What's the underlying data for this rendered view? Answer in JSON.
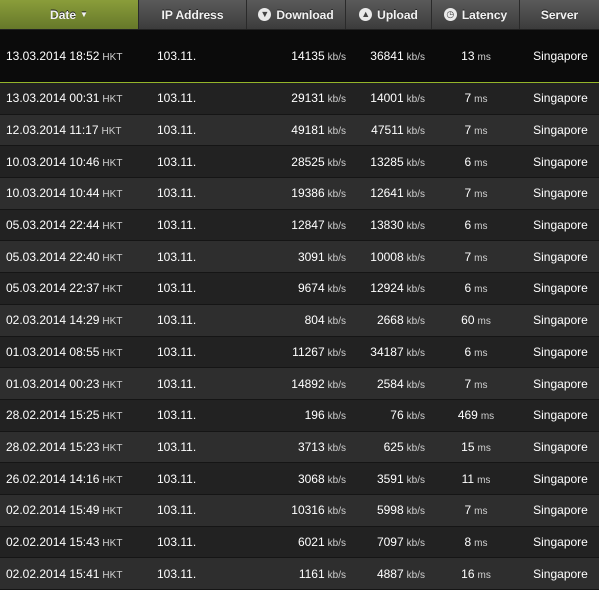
{
  "header": {
    "date": "Date",
    "ip": "IP Address",
    "download": "Download",
    "upload": "Upload",
    "latency": "Latency",
    "server": "Server"
  },
  "icons": {
    "download": "download-icon",
    "upload": "upload-icon",
    "latency": "latency-icon",
    "sort": "caret-down-icon"
  },
  "colors": {
    "active_header": "#7a8d32",
    "highlight_border": "#94b52a"
  },
  "rows": [
    {
      "date": "13.03.2014 18:52",
      "tz": "HKT",
      "ip": "103.11.",
      "dl": "14135",
      "dl_unit": "kb/s",
      "ul": "36841",
      "ul_unit": "kb/s",
      "lat": "13",
      "lat_unit": "ms",
      "server": "Singapore"
    },
    {
      "date": "13.03.2014 00:31",
      "tz": "HKT",
      "ip": "103.11.",
      "dl": "29131",
      "dl_unit": "kb/s",
      "ul": "14001",
      "ul_unit": "kb/s",
      "lat": "7",
      "lat_unit": "ms",
      "server": "Singapore"
    },
    {
      "date": "12.03.2014 11:17",
      "tz": "HKT",
      "ip": "103.11.",
      "dl": "49181",
      "dl_unit": "kb/s",
      "ul": "47511",
      "ul_unit": "kb/s",
      "lat": "7",
      "lat_unit": "ms",
      "server": "Singapore"
    },
    {
      "date": "10.03.2014 10:46",
      "tz": "HKT",
      "ip": "103.11.",
      "dl": "28525",
      "dl_unit": "kb/s",
      "ul": "13285",
      "ul_unit": "kb/s",
      "lat": "6",
      "lat_unit": "ms",
      "server": "Singapore"
    },
    {
      "date": "10.03.2014 10:44",
      "tz": "HKT",
      "ip": "103.11.",
      "dl": "19386",
      "dl_unit": "kb/s",
      "ul": "12641",
      "ul_unit": "kb/s",
      "lat": "7",
      "lat_unit": "ms",
      "server": "Singapore"
    },
    {
      "date": "05.03.2014 22:44",
      "tz": "HKT",
      "ip": "103.11.",
      "dl": "12847",
      "dl_unit": "kb/s",
      "ul": "13830",
      "ul_unit": "kb/s",
      "lat": "6",
      "lat_unit": "ms",
      "server": "Singapore"
    },
    {
      "date": "05.03.2014 22:40",
      "tz": "HKT",
      "ip": "103.11.",
      "dl": "3091",
      "dl_unit": "kb/s",
      "ul": "10008",
      "ul_unit": "kb/s",
      "lat": "7",
      "lat_unit": "ms",
      "server": "Singapore"
    },
    {
      "date": "05.03.2014 22:37",
      "tz": "HKT",
      "ip": "103.11.",
      "dl": "9674",
      "dl_unit": "kb/s",
      "ul": "12924",
      "ul_unit": "kb/s",
      "lat": "6",
      "lat_unit": "ms",
      "server": "Singapore"
    },
    {
      "date": "02.03.2014 14:29",
      "tz": "HKT",
      "ip": "103.11.",
      "dl": "804",
      "dl_unit": "kb/s",
      "ul": "2668",
      "ul_unit": "kb/s",
      "lat": "60",
      "lat_unit": "ms",
      "server": "Singapore"
    },
    {
      "date": "01.03.2014 08:55",
      "tz": "HKT",
      "ip": "103.11.",
      "dl": "11267",
      "dl_unit": "kb/s",
      "ul": "34187",
      "ul_unit": "kb/s",
      "lat": "6",
      "lat_unit": "ms",
      "server": "Singapore"
    },
    {
      "date": "01.03.2014 00:23",
      "tz": "HKT",
      "ip": "103.11.",
      "dl": "14892",
      "dl_unit": "kb/s",
      "ul": "2584",
      "ul_unit": "kb/s",
      "lat": "7",
      "lat_unit": "ms",
      "server": "Singapore"
    },
    {
      "date": "28.02.2014 15:25",
      "tz": "HKT",
      "ip": "103.11.",
      "dl": "196",
      "dl_unit": "kb/s",
      "ul": "76",
      "ul_unit": "kb/s",
      "lat": "469",
      "lat_unit": "ms",
      "server": "Singapore"
    },
    {
      "date": "28.02.2014 15:23",
      "tz": "HKT",
      "ip": "103.11.",
      "dl": "3713",
      "dl_unit": "kb/s",
      "ul": "625",
      "ul_unit": "kb/s",
      "lat": "15",
      "lat_unit": "ms",
      "server": "Singapore"
    },
    {
      "date": "26.02.2014 14:16",
      "tz": "HKT",
      "ip": "103.11.",
      "dl": "3068",
      "dl_unit": "kb/s",
      "ul": "3591",
      "ul_unit": "kb/s",
      "lat": "11",
      "lat_unit": "ms",
      "server": "Singapore"
    },
    {
      "date": "02.02.2014 15:49",
      "tz": "HKT",
      "ip": "103.11.",
      "dl": "10316",
      "dl_unit": "kb/s",
      "ul": "5998",
      "ul_unit": "kb/s",
      "lat": "7",
      "lat_unit": "ms",
      "server": "Singapore"
    },
    {
      "date": "02.02.2014 15:43",
      "tz": "HKT",
      "ip": "103.11.",
      "dl": "6021",
      "dl_unit": "kb/s",
      "ul": "7097",
      "ul_unit": "kb/s",
      "lat": "8",
      "lat_unit": "ms",
      "server": "Singapore"
    },
    {
      "date": "02.02.2014 15:41",
      "tz": "HKT",
      "ip": "103.11.",
      "dl": "1161",
      "dl_unit": "kb/s",
      "ul": "4887",
      "ul_unit": "kb/s",
      "lat": "16",
      "lat_unit": "ms",
      "server": "Singapore"
    }
  ]
}
